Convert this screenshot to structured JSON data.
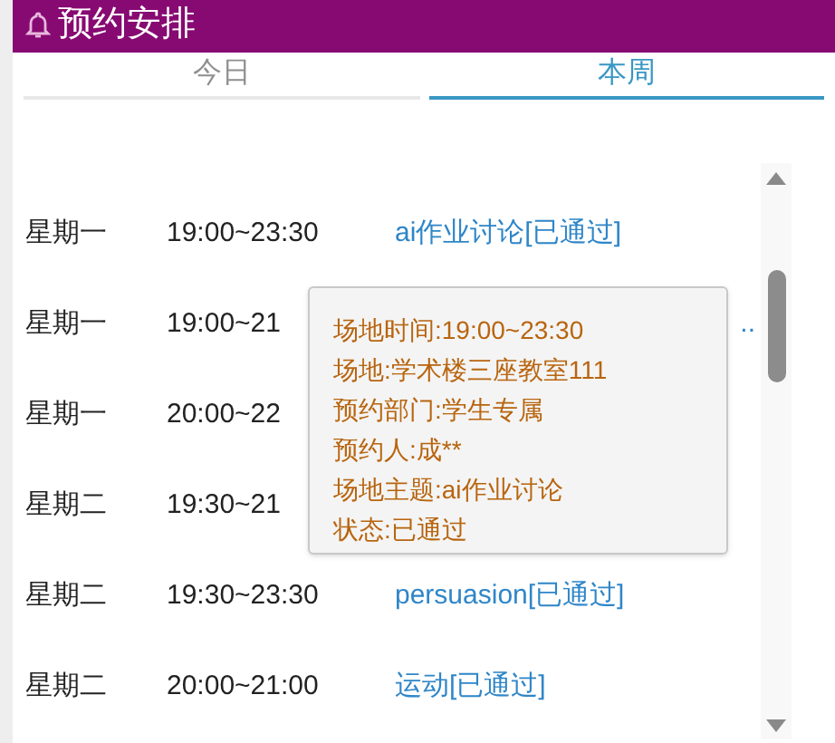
{
  "header": {
    "title": "预约安排"
  },
  "tabs": [
    {
      "label": "今日",
      "selected": false
    },
    {
      "label": "本周",
      "selected": true
    }
  ],
  "rows": [
    {
      "day": "星期一",
      "time": "19:00~23:30",
      "title": "ai作业讨论[已通过]"
    },
    {
      "day": "星期一",
      "time": "19:00~21",
      "title_tail": ".."
    },
    {
      "day": "星期一",
      "time": "20:00~22"
    },
    {
      "day": "星期二",
      "time": "19:30~21"
    },
    {
      "day": "星期二",
      "time": "19:30~23:30",
      "title": "persuasion[已通过]"
    },
    {
      "day": "星期二",
      "time": "20:00~21:00",
      "title": "运动[已通过]"
    }
  ],
  "tooltip": {
    "lines": [
      "场地时间:19:00~23:30",
      "场地:学术楼三座教室111",
      "预约部门:学生专属",
      "预约人:成**",
      "场地主题:ai作业讨论",
      "状态:已通过"
    ]
  }
}
